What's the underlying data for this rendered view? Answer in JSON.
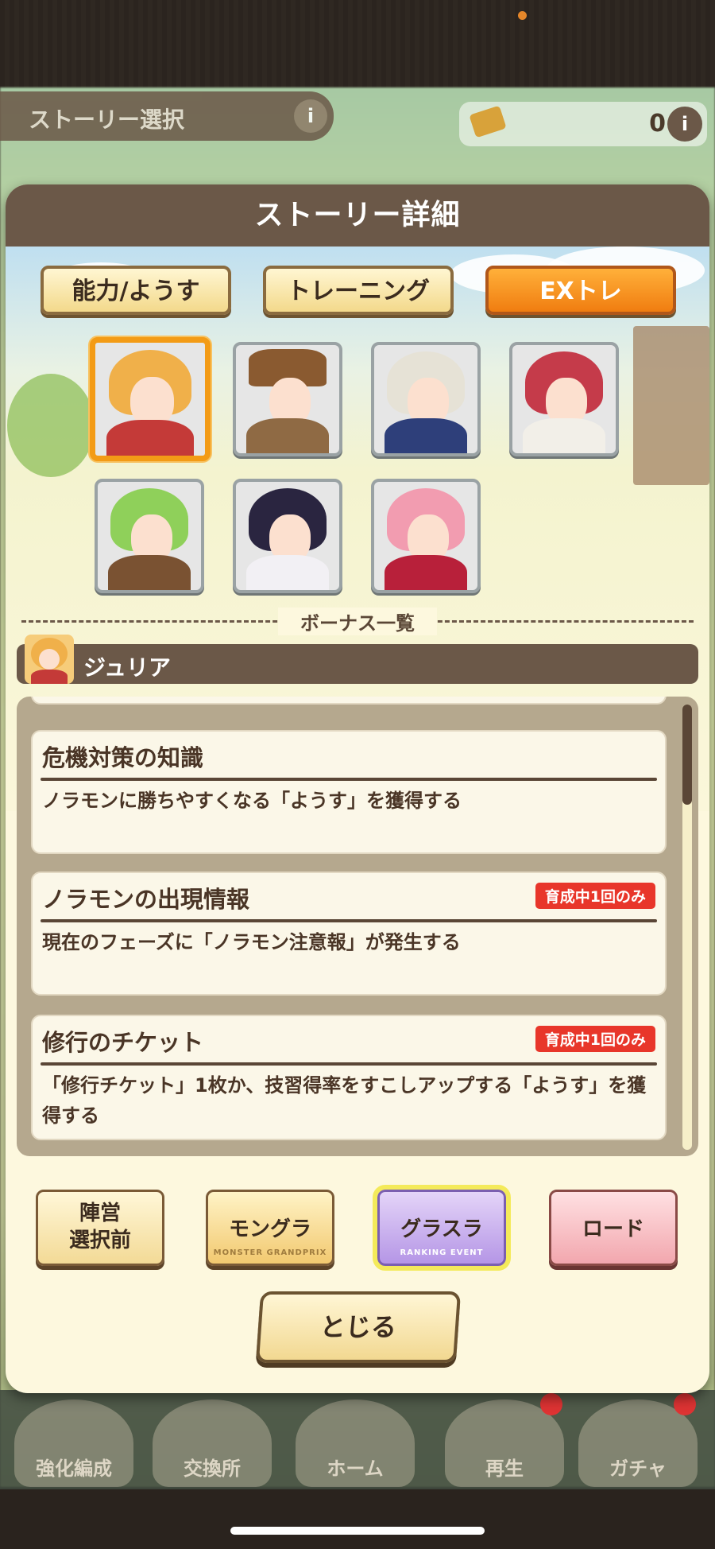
{
  "background": {
    "title": "ストーリー選択",
    "currency_value": "0",
    "nav": [
      "強化編成",
      "交換所",
      "ホーム",
      "再生",
      "ガチャ"
    ]
  },
  "modal": {
    "title": "ストーリー詳細",
    "tabs": [
      {
        "label": "能力/ようす",
        "active": false
      },
      {
        "label": "トレーニング",
        "active": false
      },
      {
        "label": "EXトレ",
        "active": true
      }
    ],
    "characters": [
      {
        "name": "ジュリア",
        "selected": true
      },
      {
        "name": "",
        "selected": false
      },
      {
        "name": "",
        "selected": false
      },
      {
        "name": "",
        "selected": false
      },
      {
        "name": "",
        "selected": false
      },
      {
        "name": "",
        "selected": false
      },
      {
        "name": "",
        "selected": false
      }
    ],
    "bonus_header": "ボーナス一覧",
    "selected_character": "ジュリア",
    "bonuses": [
      {
        "title": "危機対策の知識",
        "desc": "ノラモンに勝ちやすくなる「ようす」を獲得する",
        "badge": ""
      },
      {
        "title": "ノラモンの出現情報",
        "desc": "現在のフェーズに「ノラモン注意報」が発生する",
        "badge": "育成中1回のみ"
      },
      {
        "title": "修行のチケット",
        "desc": "「修行チケット」1枚か、技習得率をすこしアップする「ようす」を獲得する",
        "badge": "育成中1回のみ"
      }
    ],
    "mode_buttons": [
      {
        "label": "陣営\n選択前",
        "sub": ""
      },
      {
        "label": "モングラ",
        "sub": "MONSTER GRANDPRIX"
      },
      {
        "label": "グラスラ",
        "sub": "RANKING EVENT"
      },
      {
        "label": "ロード",
        "sub": ""
      }
    ],
    "close_label": "とじる"
  },
  "colors": {
    "header": "#6b5848",
    "active_tab": "#f07d10",
    "badge": "#e8362a",
    "selected_border": "#f39b16"
  }
}
